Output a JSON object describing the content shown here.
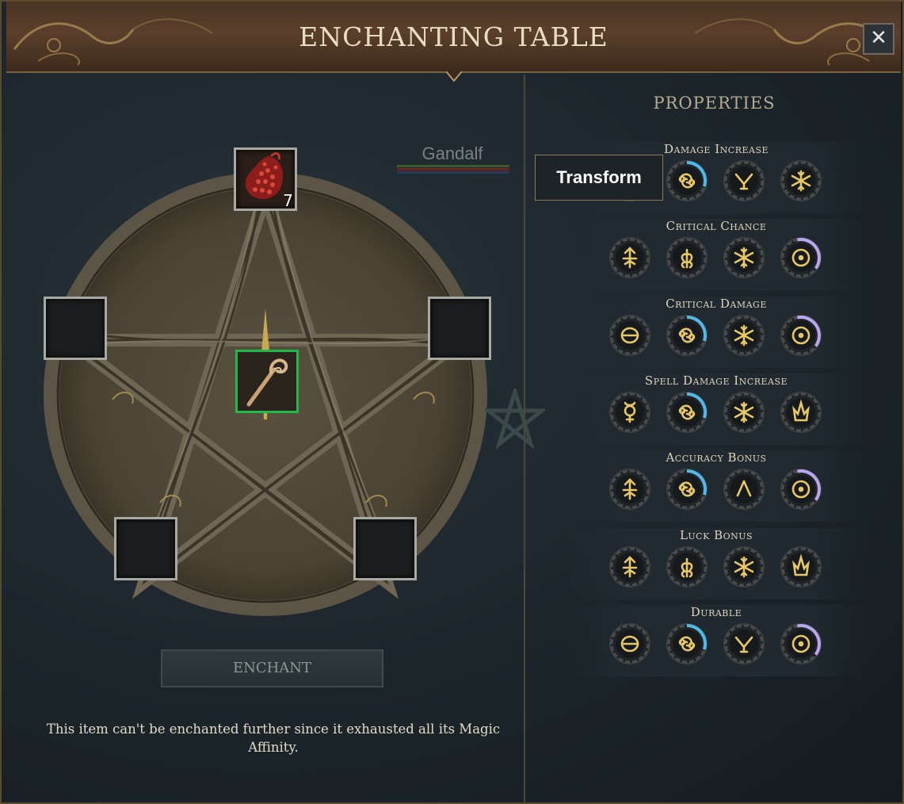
{
  "window": {
    "title": "ENCHANTING TABLE",
    "close_label": "✕"
  },
  "table": {
    "top_slot": {
      "item": "red-crystal",
      "count": "7"
    },
    "center_slot": {
      "item": "staff",
      "selected": true
    },
    "player_name": "Gandalf",
    "player_bar_colors": [
      "#3d5a2a",
      "#6b2222",
      "#2a3a5a"
    ]
  },
  "enchant_button": "ENCHANT",
  "notice": "This item can't be enchanted further since it exhausted all its Magic Affinity.",
  "properties": {
    "title": "PROPERTIES",
    "rows": [
      {
        "name": "Damage Increase",
        "runes": [
          {
            "icon": "hidden-rune",
            "ring": 0.0
          },
          {
            "icon": "cancer-rune",
            "ring": 0.3
          },
          {
            "icon": "fork-rune",
            "ring": 0.0
          },
          {
            "icon": "snowflake-rune",
            "ring": 0.0
          }
        ]
      },
      {
        "name": "Critical Chance",
        "runes": [
          {
            "icon": "arrow-rune",
            "ring": 0.0
          },
          {
            "icon": "wheat-rune",
            "ring": 0.0
          },
          {
            "icon": "snowflake-rune",
            "ring": 0.0
          },
          {
            "icon": "circle-dot-rune",
            "ring": 0.35
          }
        ]
      },
      {
        "name": "Critical Damage",
        "runes": [
          {
            "icon": "theta-rune",
            "ring": 0.0
          },
          {
            "icon": "cancer-rune",
            "ring": 0.3
          },
          {
            "icon": "snowflake-rune",
            "ring": 0.0
          },
          {
            "icon": "circle-dot-rune",
            "ring": 0.35
          }
        ]
      },
      {
        "name": "Spell Damage Increase",
        "runes": [
          {
            "icon": "mercury-rune",
            "ring": 0.0
          },
          {
            "icon": "cancer-rune",
            "ring": 0.3
          },
          {
            "icon": "snowflake-rune",
            "ring": 0.0
          },
          {
            "icon": "flame-rune",
            "ring": 0.0
          }
        ]
      },
      {
        "name": "Accuracy Bonus",
        "runes": [
          {
            "icon": "arrow-rune",
            "ring": 0.0
          },
          {
            "icon": "cancer-rune",
            "ring": 0.3
          },
          {
            "icon": "lambda-rune",
            "ring": 0.0
          },
          {
            "icon": "circle-dot-rune",
            "ring": 0.35
          }
        ]
      },
      {
        "name": "Luck Bonus",
        "runes": [
          {
            "icon": "arrow-rune",
            "ring": 0.0
          },
          {
            "icon": "wheat-rune",
            "ring": 0.0
          },
          {
            "icon": "snowflake-rune",
            "ring": 0.0
          },
          {
            "icon": "flame-rune",
            "ring": 0.0
          }
        ]
      },
      {
        "name": "Durable",
        "runes": [
          {
            "icon": "theta-rune",
            "ring": 0.0
          },
          {
            "icon": "cancer-rune",
            "ring": 0.3
          },
          {
            "icon": "fork-rune",
            "ring": 0.0
          },
          {
            "icon": "circle-dot-rune",
            "ring": 0.35
          }
        ]
      }
    ]
  },
  "tooltip": "Transform",
  "colors": {
    "rune_gold": "#e8c766",
    "ring_blue": "#52b8e8",
    "ring_violet": "#b9a6f0",
    "selected_green": "#20b84a"
  }
}
